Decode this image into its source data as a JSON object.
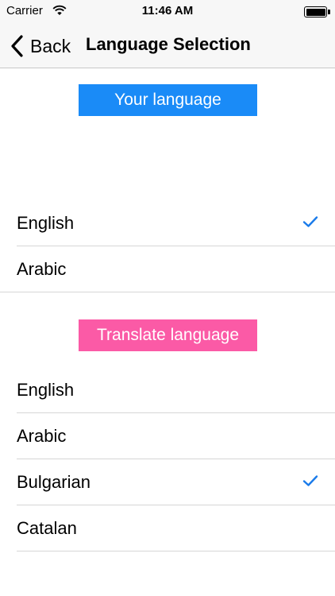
{
  "status_bar": {
    "carrier": "Carrier",
    "time": "11:46 AM",
    "icons": [
      "wifi-icon",
      "battery-icon"
    ]
  },
  "nav": {
    "back_label": "Back",
    "back_icon": "chevron-left-icon",
    "title": "Language Selection"
  },
  "your_language": {
    "header": "Your language",
    "color": "#1a8bf7",
    "items": [
      {
        "label": "English",
        "checked": true
      },
      {
        "label": "Arabic",
        "checked": false
      }
    ]
  },
  "translate_language": {
    "header": "Translate language",
    "color": "#fb5aa6",
    "items": [
      {
        "label": "English",
        "checked": false
      },
      {
        "label": "Arabic",
        "checked": false
      },
      {
        "label": "Bulgarian",
        "checked": true
      },
      {
        "label": "Catalan",
        "checked": false
      }
    ]
  },
  "colors": {
    "check": "#1a7bea",
    "separator": "#d6d6d6"
  }
}
